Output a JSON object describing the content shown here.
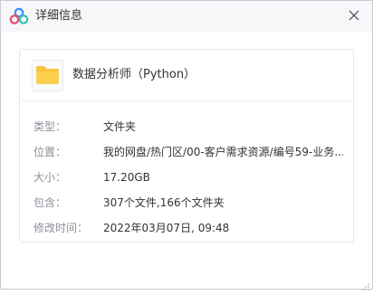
{
  "window": {
    "title": "详细信息",
    "icons": {
      "app": "cloud-drive-logo-icon",
      "close": "close-icon",
      "item": "folder-icon"
    }
  },
  "colors": {
    "titlebar_bg": "#f6f7f9",
    "label": "#8a8f99",
    "value": "#333333",
    "folder": "#f9c33a"
  },
  "file": {
    "name": "数据分析师（Python）",
    "properties": [
      {
        "label": "类型：",
        "value": "文件夹"
      },
      {
        "label": "位置：",
        "value": "我的网盘/热门区/00-客户需求资源/编号59-业务..."
      },
      {
        "label": "大小：",
        "value": "17.20GB"
      },
      {
        "label": "包含：",
        "value": "307个文件,166个文件夹"
      },
      {
        "label": "修改时间：",
        "value": "2022年03月07日, 09:48"
      }
    ]
  }
}
